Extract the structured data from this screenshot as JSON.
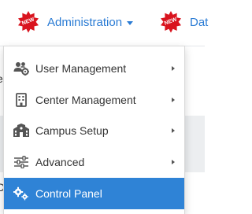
{
  "colors": {
    "link": "#2a7bd4",
    "badge_red": "#d9141e",
    "active_bg": "#2f83d6",
    "menu_text": "#333333"
  },
  "navbar": {
    "admin": {
      "badge_text": "NEW",
      "label": "Administration",
      "icon": "new-badge-icon"
    },
    "dat": {
      "badge_text": "NEW",
      "label": "Dat",
      "icon": "new-badge-icon"
    }
  },
  "admin_menu": {
    "items": [
      {
        "label": "User Management",
        "icon": "users-cog-icon",
        "submenu": true
      },
      {
        "label": "Center Management",
        "icon": "building-icon",
        "submenu": true
      },
      {
        "label": "Campus Setup",
        "icon": "campus-icon",
        "submenu": true
      },
      {
        "label": "Advanced",
        "icon": "sliders-icon",
        "submenu": true
      },
      {
        "label": "Control Panel",
        "icon": "cogs-icon",
        "submenu": false,
        "active": true
      }
    ]
  }
}
